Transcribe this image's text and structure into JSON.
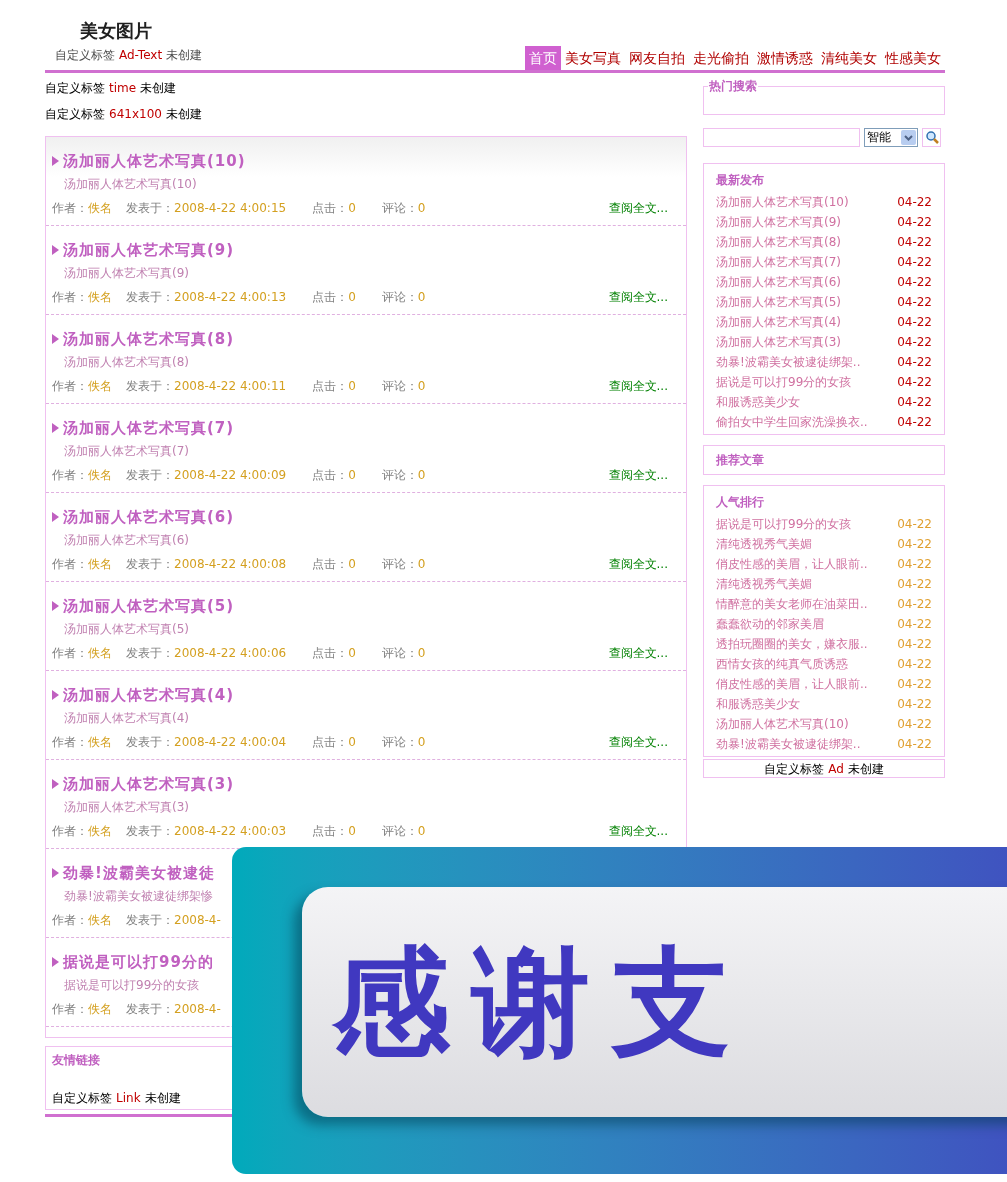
{
  "header": {
    "logo": "美女图片",
    "ad_tag": {
      "prefix": "自定义标签",
      "name": "Ad-Text",
      "suffix": "未创建"
    }
  },
  "nav": [
    {
      "label": "首页",
      "selected": true
    },
    {
      "label": "美女写真",
      "selected": false
    },
    {
      "label": "网友自拍",
      "selected": false
    },
    {
      "label": "走光偷拍",
      "selected": false
    },
    {
      "label": "激情诱惑",
      "selected": false
    },
    {
      "label": "清纯美女",
      "selected": false
    },
    {
      "label": "性感美女",
      "selected": false
    }
  ],
  "custom_tags": [
    {
      "prefix": "自定义标签",
      "name": "time",
      "suffix": "未创建"
    },
    {
      "prefix": "自定义标签",
      "name": "641x100",
      "suffix": "未创建"
    }
  ],
  "posts": [
    {
      "title": "汤加丽人体艺术写真(10)",
      "summary": "汤加丽人体艺术写真(10)",
      "author_label": "作者：",
      "author": "佚名",
      "date_label": "发表于：",
      "date": "2008-4-22 4:00:15",
      "hits_label": "点击：",
      "hits": "0",
      "comments_label": "评论：",
      "comments": "0",
      "more": "查阅全文..."
    },
    {
      "title": "汤加丽人体艺术写真(9)",
      "summary": "汤加丽人体艺术写真(9)",
      "author_label": "作者：",
      "author": "佚名",
      "date_label": "发表于：",
      "date": "2008-4-22 4:00:13",
      "hits_label": "点击：",
      "hits": "0",
      "comments_label": "评论：",
      "comments": "0",
      "more": "查阅全文..."
    },
    {
      "title": "汤加丽人体艺术写真(8)",
      "summary": "汤加丽人体艺术写真(8)",
      "author_label": "作者：",
      "author": "佚名",
      "date_label": "发表于：",
      "date": "2008-4-22 4:00:11",
      "hits_label": "点击：",
      "hits": "0",
      "comments_label": "评论：",
      "comments": "0",
      "more": "查阅全文..."
    },
    {
      "title": "汤加丽人体艺术写真(7)",
      "summary": "汤加丽人体艺术写真(7)",
      "author_label": "作者：",
      "author": "佚名",
      "date_label": "发表于：",
      "date": "2008-4-22 4:00:09",
      "hits_label": "点击：",
      "hits": "0",
      "comments_label": "评论：",
      "comments": "0",
      "more": "查阅全文..."
    },
    {
      "title": "汤加丽人体艺术写真(6)",
      "summary": "汤加丽人体艺术写真(6)",
      "author_label": "作者：",
      "author": "佚名",
      "date_label": "发表于：",
      "date": "2008-4-22 4:00:08",
      "hits_label": "点击：",
      "hits": "0",
      "comments_label": "评论：",
      "comments": "0",
      "more": "查阅全文..."
    },
    {
      "title": "汤加丽人体艺术写真(5)",
      "summary": "汤加丽人体艺术写真(5)",
      "author_label": "作者：",
      "author": "佚名",
      "date_label": "发表于：",
      "date": "2008-4-22 4:00:06",
      "hits_label": "点击：",
      "hits": "0",
      "comments_label": "评论：",
      "comments": "0",
      "more": "查阅全文..."
    },
    {
      "title": "汤加丽人体艺术写真(4)",
      "summary": "汤加丽人体艺术写真(4)",
      "author_label": "作者：",
      "author": "佚名",
      "date_label": "发表于：",
      "date": "2008-4-22 4:00:04",
      "hits_label": "点击：",
      "hits": "0",
      "comments_label": "评论：",
      "comments": "0",
      "more": "查阅全文..."
    },
    {
      "title": "汤加丽人体艺术写真(3)",
      "summary": "汤加丽人体艺术写真(3)",
      "author_label": "作者：",
      "author": "佚名",
      "date_label": "发表于：",
      "date": "2008-4-22 4:00:03",
      "hits_label": "点击：",
      "hits": "0",
      "comments_label": "评论：",
      "comments": "0",
      "more": "查阅全文..."
    },
    {
      "title": "劲暴!波霸美女被逮徒",
      "summary": "劲暴!波霸美女被逮徒绑架惨",
      "author_label": "作者：",
      "author": "佚名",
      "date_label": "发表于：",
      "date": "2008-4-"
    },
    {
      "title": "据说是可以打99分的",
      "summary": "据说是可以打99分的女孩",
      "author_label": "作者：",
      "author": "佚名",
      "date_label": "发表于：",
      "date": "2008-4-"
    }
  ],
  "links_box": {
    "title": "友情链接",
    "tag": {
      "prefix": "自定义标签",
      "name": "Link",
      "suffix": "未创建"
    }
  },
  "sidebar": {
    "hot_search": {
      "title": "热门搜索"
    },
    "search": {
      "select": "智能"
    },
    "latest": {
      "title": "最新发布",
      "items": [
        {
          "title": "汤加丽人体艺术写真(10)",
          "date": "04-22"
        },
        {
          "title": "汤加丽人体艺术写真(9)",
          "date": "04-22"
        },
        {
          "title": "汤加丽人体艺术写真(8)",
          "date": "04-22"
        },
        {
          "title": "汤加丽人体艺术写真(7)",
          "date": "04-22"
        },
        {
          "title": "汤加丽人体艺术写真(6)",
          "date": "04-22"
        },
        {
          "title": "汤加丽人体艺术写真(5)",
          "date": "04-22"
        },
        {
          "title": "汤加丽人体艺术写真(4)",
          "date": "04-22"
        },
        {
          "title": "汤加丽人体艺术写真(3)",
          "date": "04-22"
        },
        {
          "title": "劲暴!波霸美女被逮徒绑架..",
          "date": "04-22"
        },
        {
          "title": "据说是可以打99分的女孩",
          "date": "04-22"
        },
        {
          "title": "和服诱惑美少女",
          "date": "04-22"
        },
        {
          "title": "偷拍女中学生回家洗澡换衣..",
          "date": "04-22"
        }
      ]
    },
    "recommended": {
      "title": "推荐文章"
    },
    "popular": {
      "title": "人气排行",
      "items": [
        {
          "title": "据说是可以打99分的女孩",
          "date": "04-22"
        },
        {
          "title": "清纯透视秀气美媚",
          "date": "04-22"
        },
        {
          "title": "俏皮性感的美眉，让人眼前..",
          "date": "04-22"
        },
        {
          "title": "清纯透视秀气美媚",
          "date": "04-22"
        },
        {
          "title": "情醉意的美女老师在油菜田..",
          "date": "04-22"
        },
        {
          "title": "蠢蠢欲动的邻家美眉",
          "date": "04-22"
        },
        {
          "title": "透拍玩圈圈的美女，嫌衣服..",
          "date": "04-22"
        },
        {
          "title": "西情女孩的纯真气质诱惑",
          "date": "04-22"
        },
        {
          "title": "俏皮性感的美眉，让人眼前..",
          "date": "04-22"
        },
        {
          "title": "和服诱惑美少女",
          "date": "04-22"
        },
        {
          "title": "汤加丽人体艺术写真(10)",
          "date": "04-22"
        },
        {
          "title": "劲暴!波霸美女被逮徒绑架..",
          "date": "04-22"
        }
      ]
    },
    "ad_tag": {
      "prefix": "自定义标签",
      "name": "Ad",
      "suffix": "未创建"
    }
  },
  "overlay_banner": {
    "text": "感谢支"
  }
}
